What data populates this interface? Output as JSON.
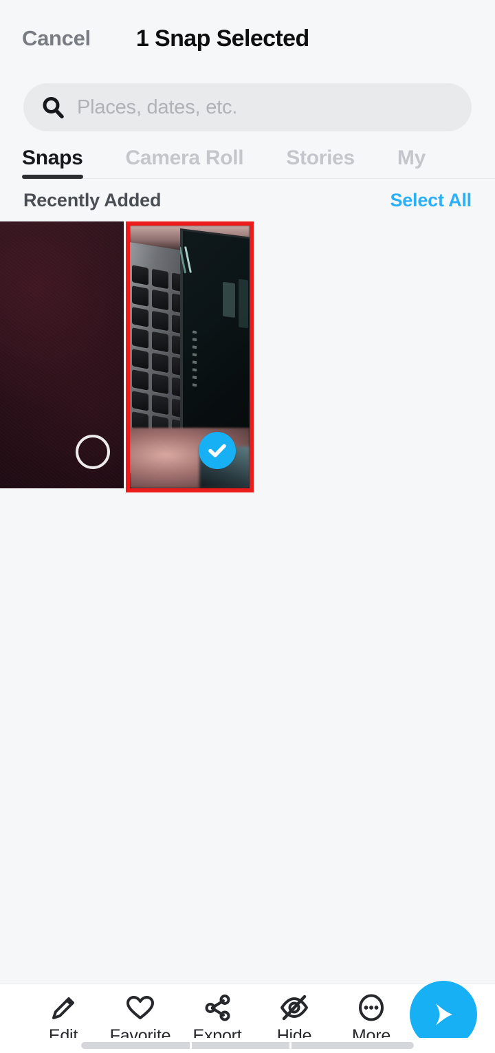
{
  "header": {
    "cancel_label": "Cancel",
    "title": "1 Snap Selected"
  },
  "search": {
    "placeholder": "Places, dates, etc.",
    "value": "",
    "icon": "search-icon"
  },
  "tabs": [
    {
      "label": "Snaps",
      "active": true
    },
    {
      "label": "Camera Roll",
      "active": false
    },
    {
      "label": "Stories",
      "active": false
    },
    {
      "label": "My",
      "active": false
    }
  ],
  "section": {
    "title": "Recently Added",
    "select_all_label": "Select All",
    "select_all_color": "#2CB0F9"
  },
  "grid": {
    "items": [
      {
        "name": "snap-thumbnail-1",
        "selected": false,
        "badge": "empty-circle"
      },
      {
        "name": "snap-thumbnail-2",
        "selected": true,
        "badge": "check-circle"
      }
    ],
    "selection_border_color": "#ED1C1C",
    "check_badge_color": "#17B0F4"
  },
  "toolbar": {
    "items": [
      {
        "label": "Edit",
        "icon": "pencil-icon"
      },
      {
        "label": "Favorite",
        "icon": "heart-icon"
      },
      {
        "label": "Export",
        "icon": "share-icon"
      },
      {
        "label": "Hide",
        "icon": "eye-slash-icon"
      },
      {
        "label": "More",
        "icon": "ellipsis-circle-icon"
      }
    ],
    "send_button": {
      "icon": "send-arrow-icon",
      "color": "#17B0F4"
    }
  }
}
